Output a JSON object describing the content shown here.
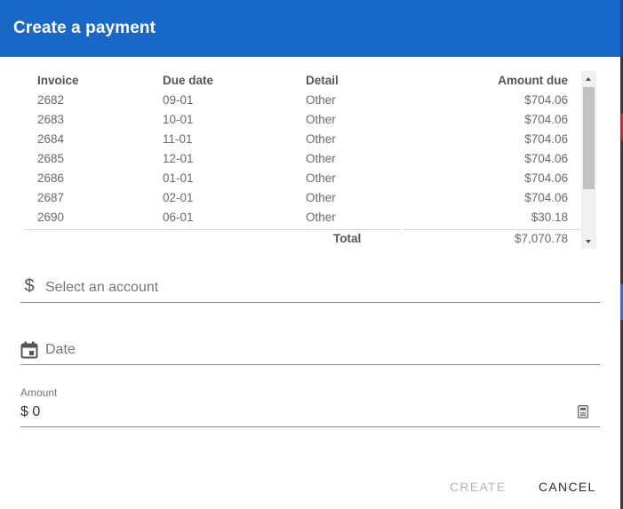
{
  "dialog": {
    "title": "Create a payment"
  },
  "table": {
    "columns": [
      "Invoice",
      "Due date",
      "Detail",
      "Amount due"
    ],
    "rows": [
      {
        "invoice": "2682",
        "due_date": "09-01",
        "detail": "Other",
        "amount": "$704.06"
      },
      {
        "invoice": "2683",
        "due_date": "10-01",
        "detail": "Other",
        "amount": "$704.06"
      },
      {
        "invoice": "2684",
        "due_date": "11-01",
        "detail": "Other",
        "amount": "$704.06"
      },
      {
        "invoice": "2685",
        "due_date": "12-01",
        "detail": "Other",
        "amount": "$704.06"
      },
      {
        "invoice": "2686",
        "due_date": "01-01",
        "detail": "Other",
        "amount": "$704.06"
      },
      {
        "invoice": "2687",
        "due_date": "02-01",
        "detail": "Other",
        "amount": "$704.06"
      },
      {
        "invoice": "2690",
        "due_date": "06-01",
        "detail": "Other",
        "amount": "$30.18"
      }
    ],
    "total_label": "Total",
    "total_value": "$7,070.78"
  },
  "form": {
    "account_placeholder": "Select an account",
    "account_icon": "dollar-icon",
    "date_placeholder": "Date",
    "date_icon": "calendar-icon",
    "amount_label": "Amount",
    "amount_value": "$ 0",
    "amount_icon": "calculator-icon"
  },
  "actions": {
    "create_label": "CREATE",
    "cancel_label": "CANCEL"
  },
  "colors": {
    "header": "#1967c6",
    "disabled_text": "#b5b5b5"
  }
}
